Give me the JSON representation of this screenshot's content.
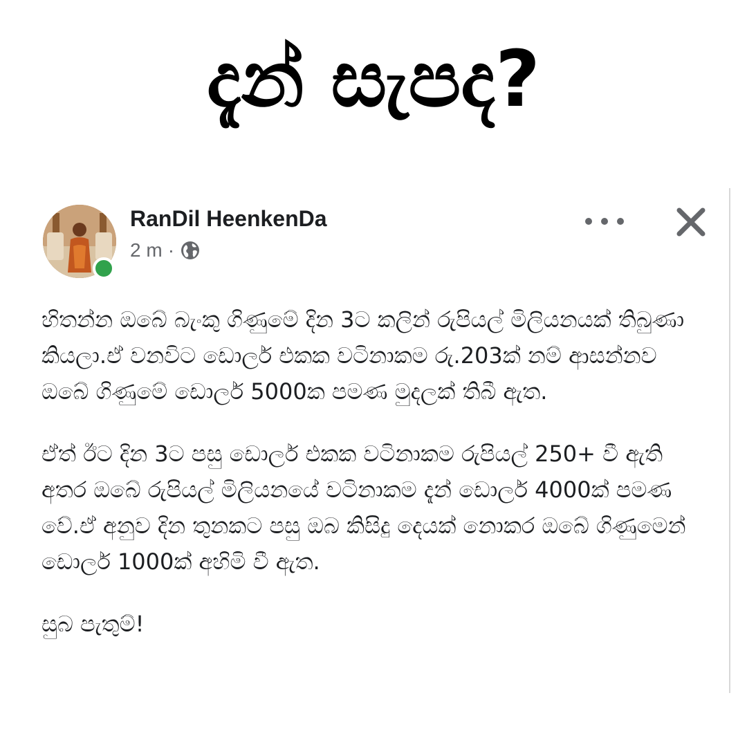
{
  "headline": "දැන් සැපද?",
  "post": {
    "author_name": "RanDil HeenkenDa",
    "timestamp": "2 m",
    "separator": "·",
    "audience_icon": "globe-icon",
    "more_icon": "more-horizontal-icon",
    "close_icon": "close-icon",
    "online_status_color": "#31a24c",
    "paragraphs": [
      "හිතන්න ඔබේ බැංකු ගිණුමේ දින 3ට කලින් රුපියල් මිලියනයක් තිබුණා කියලා.ඒ වනවිට ඩොලර් එකක වටිනාකම රු.203ක් නම් ආසන්නව ඔබේ ගිණුමේ ඩොලර් 5000ක පමණ මුදලක් තිබී ඇත.",
      "ඒත් ඊට දින 3ට පසු ඩොලර් එකක  වටිනාකම රුපියල් 250+ වී ඇති අතර ඔබේ රුපියල් මිලියනයේ වටිනාකම දැන් ඩොලර් 4000ක් පමණ වේ.ඒ අනුව දින තුනකට පසු ඔබ කිසිදු දෙයක් නොකර ඔබේ ගිණුමෙන් ඩොලර් 1000ක් අහිමි වී ඇත.",
      "සුබ පැතුම්!"
    ]
  }
}
